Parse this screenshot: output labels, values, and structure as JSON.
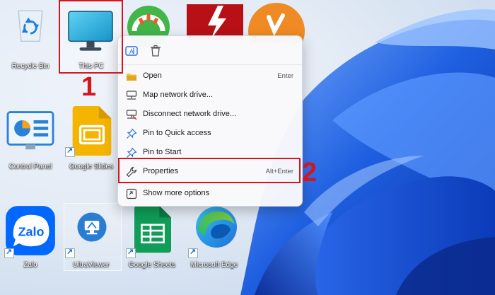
{
  "desktop": {
    "icons": [
      {
        "label": "Recycle Bin"
      },
      {
        "label": "This PC"
      },
      {
        "label": "Control Panel"
      },
      {
        "label": "Google Slides"
      },
      {
        "label": "Zalo"
      },
      {
        "label": "UltraViewer"
      },
      {
        "label": "Google Sheets"
      },
      {
        "label": "Microsoft Edge"
      }
    ]
  },
  "context_menu": {
    "toolbar": {
      "rename_icon": "rename-icon",
      "delete_icon": "trash-icon"
    },
    "items": [
      {
        "label": "Open",
        "shortcut": "Enter"
      },
      {
        "label": "Map network drive..."
      },
      {
        "label": "Disconnect network drive..."
      },
      {
        "label": "Pin to Quick access"
      },
      {
        "label": "Pin to Start"
      },
      {
        "label": "Properties",
        "shortcut": "Alt+Enter"
      },
      {
        "label": "Show more options"
      }
    ]
  },
  "annotations": {
    "step1": "1",
    "step2": "2"
  },
  "colors": {
    "highlight": "#d3161e",
    "accent": "#1a6fd1"
  }
}
